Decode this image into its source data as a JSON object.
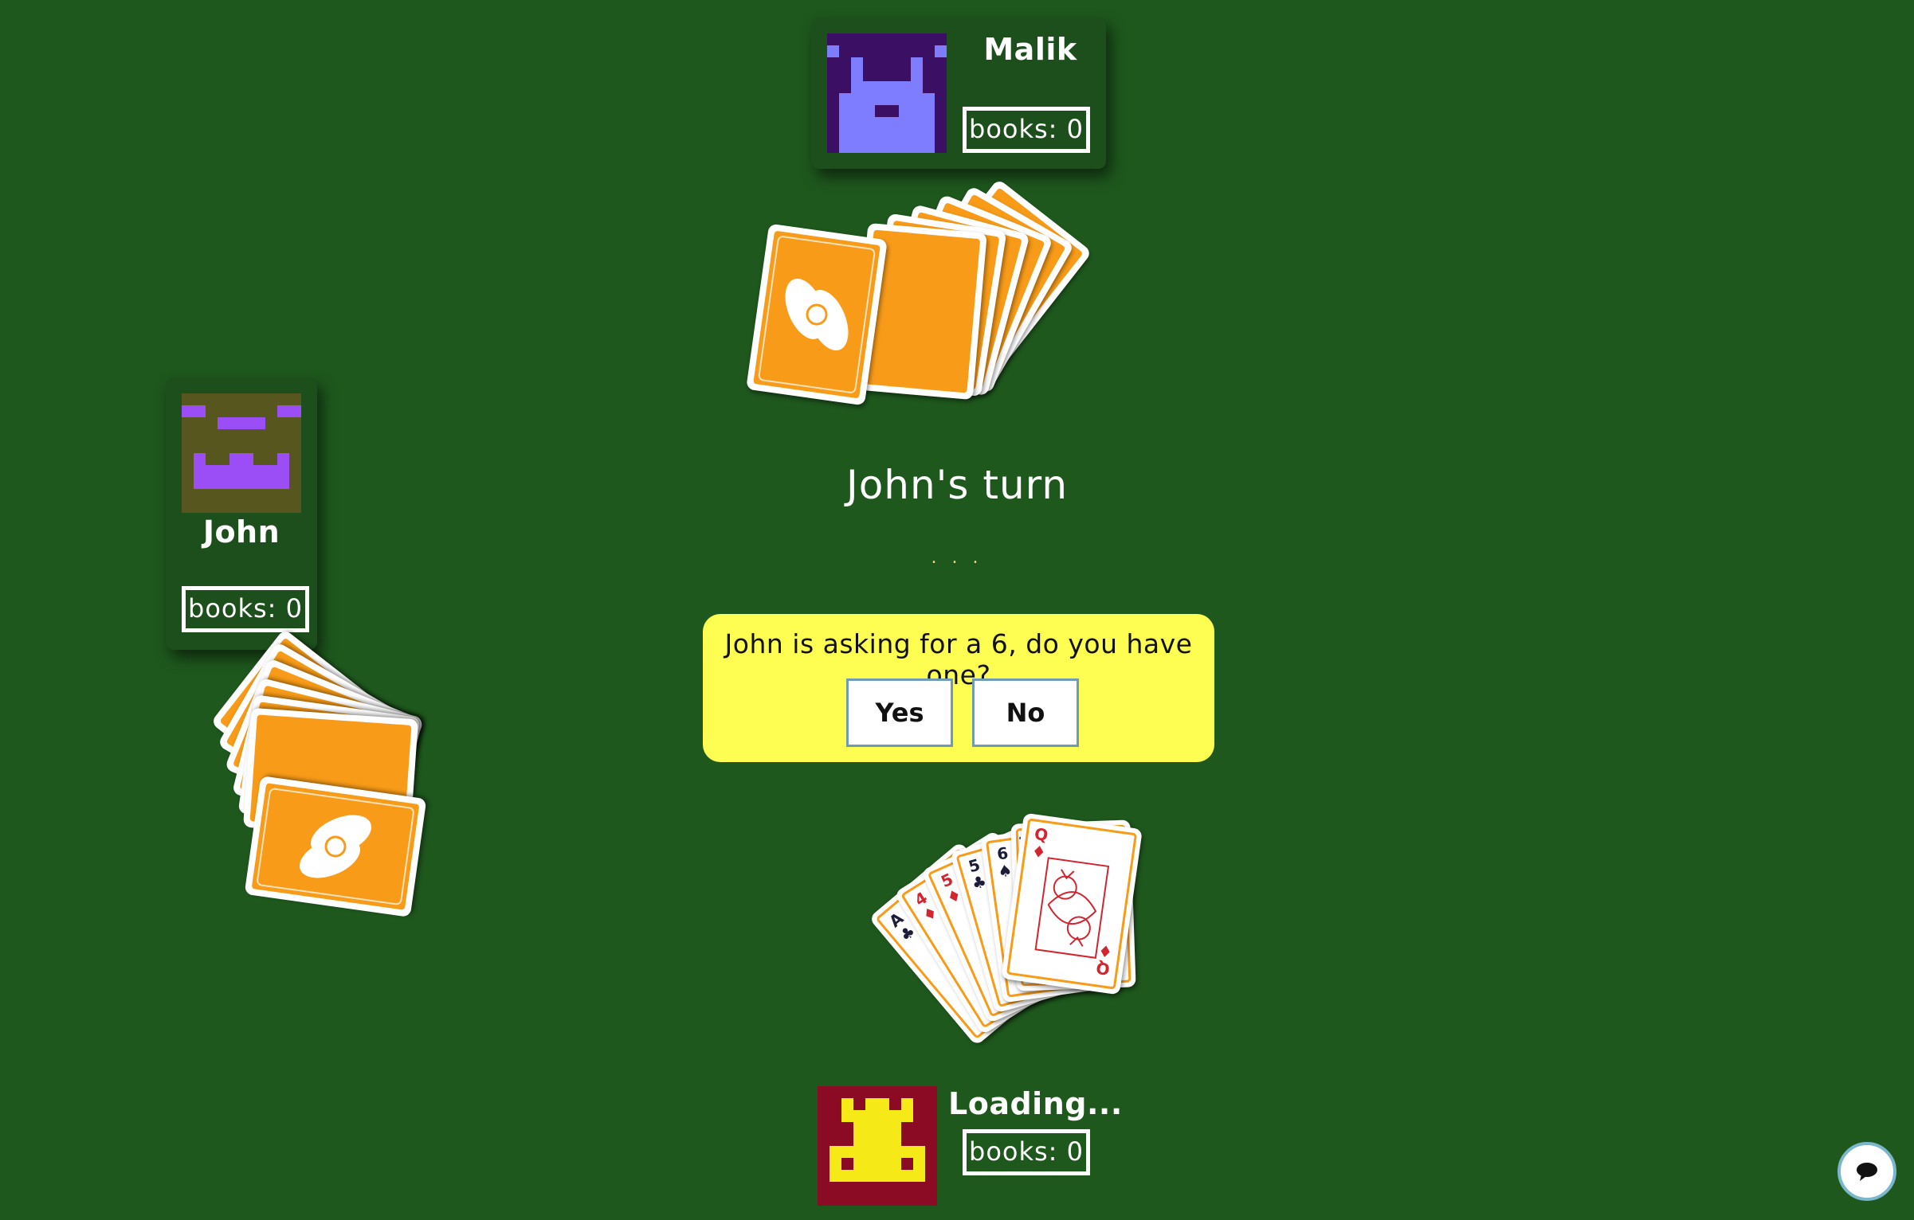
{
  "players": {
    "top": {
      "name": "Malik",
      "books_label": "books: 0",
      "avatar": "space-invader-avatar",
      "avatar_bg": "#3b0f63",
      "avatar_fg": "#7e7cff"
    },
    "left": {
      "name": "John",
      "books_label": "books: 0",
      "avatar": "monster-avatar",
      "avatar_bg": "#56561e",
      "avatar_fg": "#9b4ef5"
    },
    "bottom": {
      "name": "Loading...",
      "books_label": "books: 0",
      "avatar": "frog-avatar",
      "avatar_bg": "#8b0a24",
      "avatar_fg": "#f5ea18"
    }
  },
  "status": {
    "turn_text": "John's turn",
    "dots": ". . ."
  },
  "prompt": {
    "question": "John is asking for a 6, do you have one?",
    "yes_label": "Yes",
    "no_label": "No"
  },
  "hand": {
    "cards": [
      {
        "rank": "A",
        "suit": "♣",
        "color": "black"
      },
      {
        "rank": "4",
        "suit": "♦",
        "color": "red"
      },
      {
        "rank": "5",
        "suit": "♦",
        "color": "red"
      },
      {
        "rank": "5",
        "suit": "♣",
        "color": "black"
      },
      {
        "rank": "6",
        "suit": "♠",
        "color": "black"
      },
      {
        "rank": "10",
        "suit": "♠",
        "color": "black"
      },
      {
        "rank": "Q",
        "suit": "♦",
        "color": "red"
      }
    ]
  },
  "opponent_hands": {
    "top_count": 7,
    "left_count": 7
  },
  "chat": {
    "icon": "chat-bubble-icon"
  },
  "colors": {
    "table": "#1e581d",
    "panel": "#1c4f1c",
    "card_back": "#f89b18",
    "prompt_bg": "#fdfd52"
  }
}
